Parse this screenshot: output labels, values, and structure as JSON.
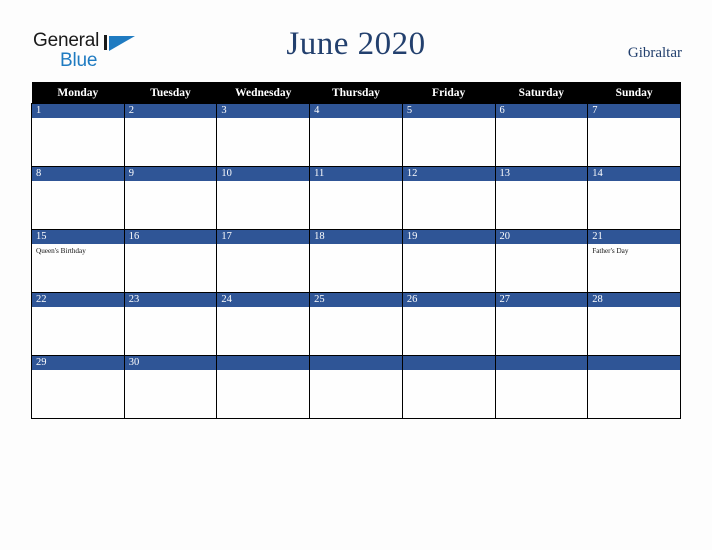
{
  "brand": {
    "name_part1": "General",
    "name_part2": "Blue"
  },
  "header": {
    "title": "June 2020",
    "country": "Gibraltar"
  },
  "calendar": {
    "weekday_headers": [
      "Monday",
      "Tuesday",
      "Wednesday",
      "Thursday",
      "Friday",
      "Saturday",
      "Sunday"
    ],
    "colors": {
      "date_bar": "#2F5596",
      "header_bar": "#000000",
      "title": "#23406E",
      "brand_blue": "#1F7BC1"
    },
    "weeks": [
      [
        {
          "day": "1",
          "events": []
        },
        {
          "day": "2",
          "events": []
        },
        {
          "day": "3",
          "events": []
        },
        {
          "day": "4",
          "events": []
        },
        {
          "day": "5",
          "events": []
        },
        {
          "day": "6",
          "events": []
        },
        {
          "day": "7",
          "events": []
        }
      ],
      [
        {
          "day": "8",
          "events": []
        },
        {
          "day": "9",
          "events": []
        },
        {
          "day": "10",
          "events": []
        },
        {
          "day": "11",
          "events": []
        },
        {
          "day": "12",
          "events": []
        },
        {
          "day": "13",
          "events": []
        },
        {
          "day": "14",
          "events": []
        }
      ],
      [
        {
          "day": "15",
          "events": [
            "Queen's Birthday"
          ]
        },
        {
          "day": "16",
          "events": []
        },
        {
          "day": "17",
          "events": []
        },
        {
          "day": "18",
          "events": []
        },
        {
          "day": "19",
          "events": []
        },
        {
          "day": "20",
          "events": []
        },
        {
          "day": "21",
          "events": [
            "Father's Day"
          ]
        }
      ],
      [
        {
          "day": "22",
          "events": []
        },
        {
          "day": "23",
          "events": []
        },
        {
          "day": "24",
          "events": []
        },
        {
          "day": "25",
          "events": []
        },
        {
          "day": "26",
          "events": []
        },
        {
          "day": "27",
          "events": []
        },
        {
          "day": "28",
          "events": []
        }
      ],
      [
        {
          "day": "29",
          "events": []
        },
        {
          "day": "30",
          "events": []
        },
        {
          "day": "",
          "events": []
        },
        {
          "day": "",
          "events": []
        },
        {
          "day": "",
          "events": []
        },
        {
          "day": "",
          "events": []
        },
        {
          "day": "",
          "events": []
        }
      ]
    ]
  }
}
